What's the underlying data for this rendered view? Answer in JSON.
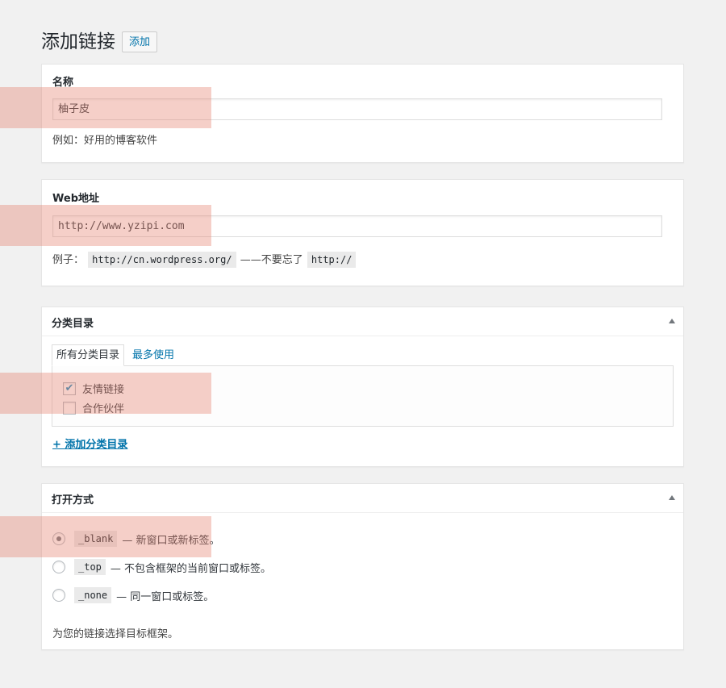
{
  "page": {
    "title": "添加链接",
    "add_new_label": "添加"
  },
  "name_box": {
    "label": "名称",
    "value": "柚子皮",
    "description": "例如：好用的博客软件"
  },
  "url_box": {
    "label": "Web地址",
    "value": "http://www.yzipi.com",
    "desc_prefix": "例子：",
    "desc_code1": "http://cn.wordpress.org/",
    "desc_middle": "——不要忘了",
    "desc_code2": "http://"
  },
  "category_box": {
    "title": "分类目录",
    "tab_all": "所有分类目录",
    "tab_popular": "最多使用",
    "items": [
      {
        "label": "友情链接",
        "checked": true
      },
      {
        "label": "合作伙伴",
        "checked": false
      }
    ],
    "add_category_label": "+ 添加分类目录"
  },
  "target_box": {
    "title": "打开方式",
    "options": [
      {
        "code": "_blank",
        "text": "— 新窗口或新标签。",
        "selected": true
      },
      {
        "code": "_top",
        "text": "— 不包含框架的当前窗口或标签。",
        "selected": false
      },
      {
        "code": "_none",
        "text": "— 同一窗口或标签。",
        "selected": false
      }
    ],
    "description": "为您的链接选择目标框架。"
  },
  "colors": {
    "link": "#0073aa",
    "background": "#f1f1f1",
    "highlight": "rgba(228,130,110,0.38)"
  }
}
